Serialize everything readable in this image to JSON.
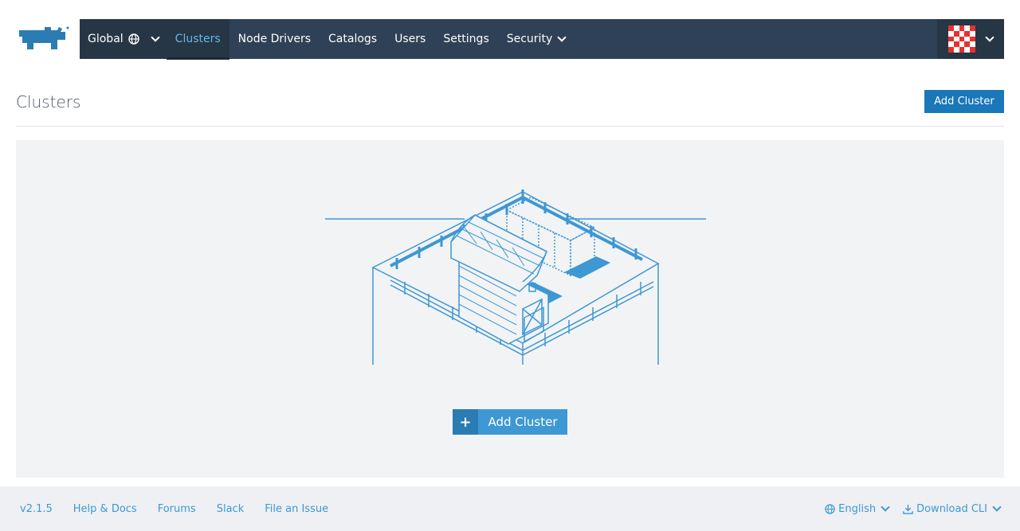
{
  "navbar": {
    "scope_label": "Global",
    "items": [
      {
        "label": "Clusters",
        "active": true
      },
      {
        "label": "Node Drivers"
      },
      {
        "label": "Catalogs"
      },
      {
        "label": "Users"
      },
      {
        "label": "Settings"
      },
      {
        "label": "Security"
      }
    ]
  },
  "page": {
    "title": "Clusters",
    "add_cluster_label": "Add Cluster"
  },
  "empty_state": {
    "add_cluster_label": "Add Cluster",
    "plus_symbol": "+"
  },
  "footer": {
    "version": "v2.1.5",
    "links": [
      "Help & Docs",
      "Forums",
      "Slack",
      "File an Issue"
    ],
    "language": "English",
    "download_cli": "Download CLI"
  },
  "colors": {
    "navbar_bg": "#2f4156",
    "active_nav_text": "#62b9e6",
    "primary_button": "#1a77b8",
    "accent": "#3d98d3",
    "illustration": "#3d98d3"
  }
}
